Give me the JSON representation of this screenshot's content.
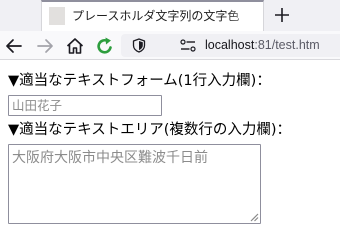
{
  "browser": {
    "tab": {
      "title": "プレースホルダ文字列の文字色",
      "favicon": "blank-page-icon"
    },
    "new_tab_icon": "plus-icon",
    "nav": {
      "back_icon": "arrow-left-icon",
      "forward_icon": "arrow-right-icon",
      "home_icon": "home-icon",
      "reload_icon": "reload-icon"
    },
    "url": {
      "shield_icon": "shield-icon",
      "permissions_icon": "permissions-icon",
      "host": "localhost",
      "rest": ":81/test.htm"
    }
  },
  "page": {
    "input_label": "▼適当なテキストフォーム(1行入力欄)：",
    "input_placeholder": "山田花子",
    "input_value": "",
    "textarea_label": "▼適当なテキストエリア(複数行の入力欄)：",
    "textarea_placeholder": "大阪府大阪市中央区難波千日前",
    "textarea_value": ""
  },
  "colors": {
    "placeholder_text": "#8c8c8c",
    "reload_green": "#2e9e3e",
    "field_border": "#8f8f9d"
  }
}
